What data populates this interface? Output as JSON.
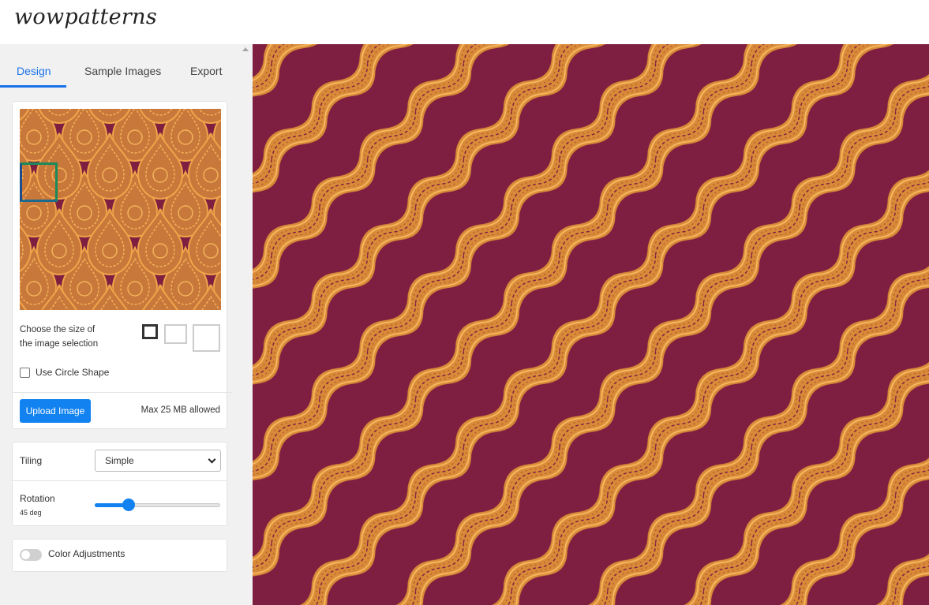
{
  "app": {
    "logo": "wowpatterns"
  },
  "tabs": [
    {
      "label": "Design",
      "active": true
    },
    {
      "label": "Sample Images",
      "active": false
    },
    {
      "label": "Export",
      "active": false
    }
  ],
  "image_card": {
    "size_label_line1": "Choose the size of",
    "size_label_line2": "the image selection",
    "circle_label": "Use Circle Shape",
    "circle_checked": false,
    "upload_label": "Upload Image",
    "max_text": "Max 25 MB allowed"
  },
  "settings": {
    "tiling_label": "Tiling",
    "tiling_value": "Simple",
    "rotation_label": "Rotation",
    "rotation_value_text": "45 deg",
    "rotation_fraction": 0.27
  },
  "color": {
    "label": "Color Adjustments",
    "enabled": false
  },
  "colors": {
    "accent": "#1282f0",
    "pattern_bg": "#7e1f42",
    "pattern_gold": "#e0913a"
  }
}
